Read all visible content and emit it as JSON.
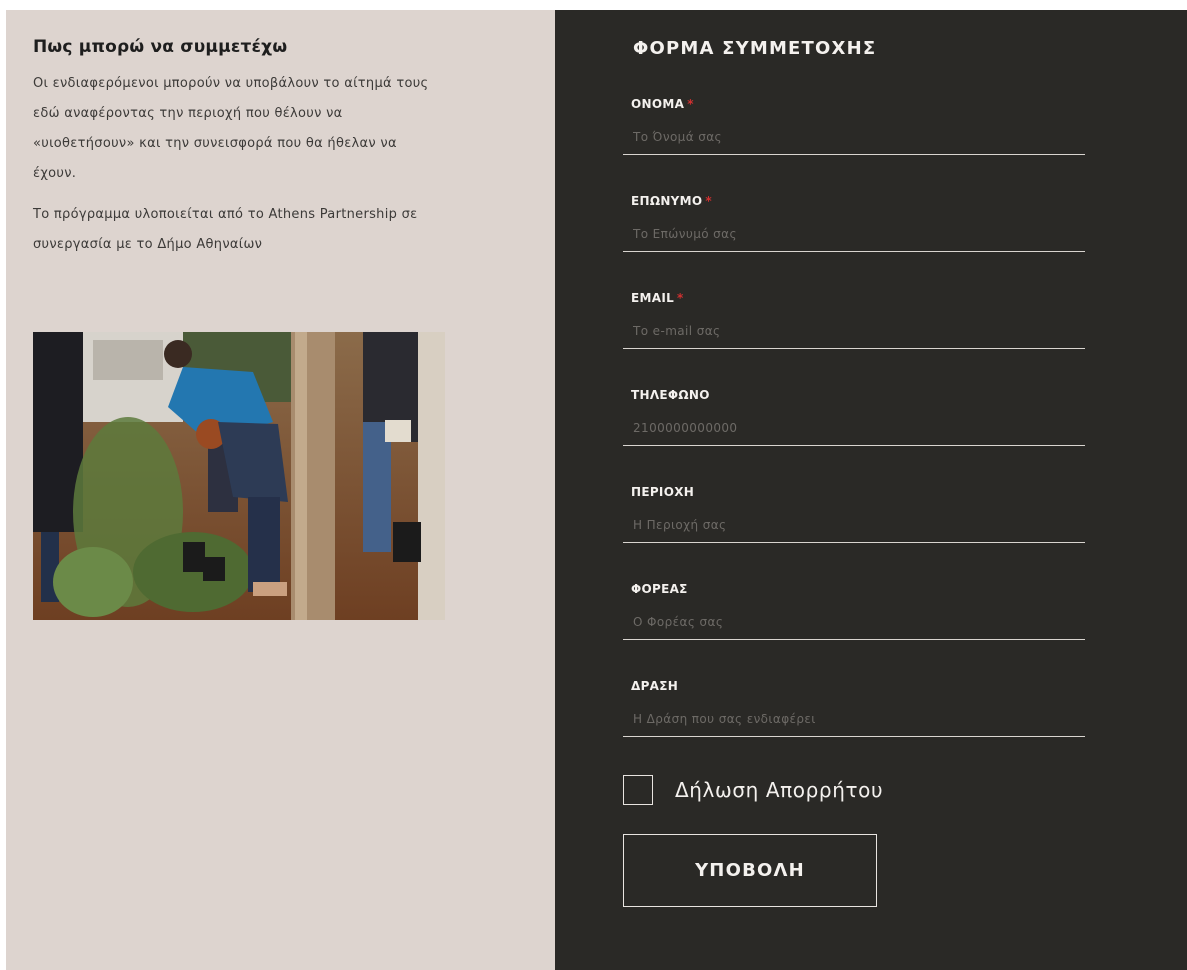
{
  "info": {
    "title": "Πως μπορώ να συμμετέχω",
    "paragraph1": "Οι ενδιαφερόμενοι μπορούν να υποβάλουν το αίτημά τους εδώ αναφέροντας την περιοχή που θέλουν να «υιοθετήσουν» και την συνεισφορά που θα ήθελαν να έχουν.",
    "paragraph2": "Το πρόγραμμα υλοποιείται από το Athens Partnership σε συνεργασία με το Δήμο Αθηναίων"
  },
  "form": {
    "title": "ΦΟΡΜΑ ΣΥΜΜΕΤΟΧΗΣ",
    "required_mark": "*",
    "fields": [
      {
        "label": "ΟΝΟΜΑ",
        "placeholder": "Το Όνομά σας",
        "required": true
      },
      {
        "label": "ΕΠΩΝΥΜΟ",
        "placeholder": "Το Επώνυμό σας",
        "required": true
      },
      {
        "label": "EMAIL",
        "placeholder": "Το e-mail σας",
        "required": true
      },
      {
        "label": "ΤΗΛΕΦΩΝΟ",
        "placeholder": "2100000000000",
        "required": false
      },
      {
        "label": "ΠΕΡΙΟΧΗ",
        "placeholder": "Η Περιοχή σας",
        "required": false
      },
      {
        "label": "ΦΟΡΕΑΣ",
        "placeholder": "Ο Φορέας σας",
        "required": false
      },
      {
        "label": "ΔΡΑΣΗ",
        "placeholder": "Η Δράση που σας ενδιαφέρει",
        "required": false
      }
    ],
    "privacy_label": "Δήλωση Απορρήτου",
    "submit_label": "ΥΠΟΒΟΛΗ"
  },
  "colors": {
    "left_bg": "#ddd4cf",
    "right_bg": "#2a2926",
    "required": "#d03030"
  }
}
